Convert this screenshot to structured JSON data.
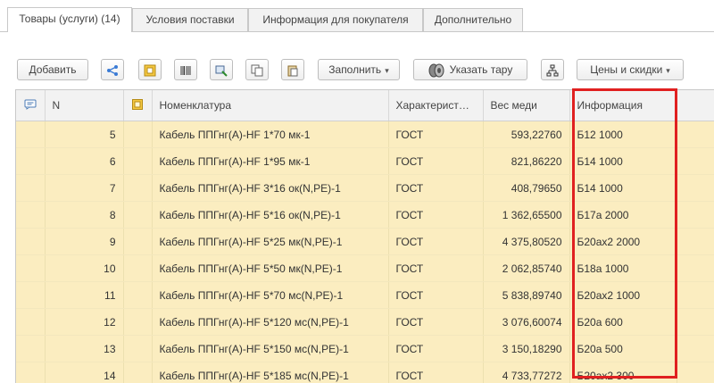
{
  "tabs": [
    {
      "label": "Товары (услуги) (14)"
    },
    {
      "label": "Условия поставки"
    },
    {
      "label": "Информация для покупателя"
    },
    {
      "label": "Дополнительно"
    }
  ],
  "toolbar": {
    "add_label": "Добавить",
    "fill_label": "Заполнить",
    "tare_label": "Указать тару",
    "prices_label": "Цены и скидки",
    "dropdown_caret": "▾"
  },
  "table": {
    "columns": {
      "n": "N",
      "nomenclature": "Номенклатура",
      "characteristic": "Характерист…",
      "weight": "Вес меди",
      "info": "Информация"
    },
    "rows": [
      {
        "n": "5",
        "name": "Кабель ППГнг(А)-HF 1*70 мк-1",
        "char": "ГОСТ",
        "weight": "593,22760",
        "info": "Б12 1000"
      },
      {
        "n": "6",
        "name": "Кабель ППГнг(А)-HF 1*95 мк-1",
        "char": "ГОСТ",
        "weight": "821,86220",
        "info": "Б14 1000"
      },
      {
        "n": "7",
        "name": "Кабель ППГнг(А)-HF 3*16 ок(N,PE)-1",
        "char": "ГОСТ",
        "weight": "408,79650",
        "info": "Б14 1000"
      },
      {
        "n": "8",
        "name": "Кабель ППГнг(А)-HF 5*16 ок(N,PE)-1",
        "char": "ГОСТ",
        "weight": "1 362,65500",
        "info": "Б17а 2000"
      },
      {
        "n": "9",
        "name": "Кабель ППГнг(А)-HF 5*25 мк(N,PE)-1",
        "char": "ГОСТ",
        "weight": "4 375,80520",
        "info": "Б20ах2 2000"
      },
      {
        "n": "10",
        "name": "Кабель ППГнг(А)-HF 5*50 мк(N,PE)-1",
        "char": "ГОСТ",
        "weight": "2 062,85740",
        "info": "Б18а 1000"
      },
      {
        "n": "11",
        "name": "Кабель ППГнг(А)-HF 5*70 мс(N,PE)-1",
        "char": "ГОСТ",
        "weight": "5 838,89740",
        "info": "Б20ах2 1000"
      },
      {
        "n": "12",
        "name": "Кабель ППГнг(А)-HF 5*120 мс(N,PE)-1",
        "char": "ГОСТ",
        "weight": "3 076,60074",
        "info": "Б20а 600"
      },
      {
        "n": "13",
        "name": "Кабель ППГнг(А)-HF 5*150 мс(N,PE)-1",
        "char": "ГОСТ",
        "weight": "3 150,18290",
        "info": "Б20а 500"
      },
      {
        "n": "14",
        "name": "Кабель ППГнг(А)-HF 5*185 мс(N,PE)-1",
        "char": "ГОСТ",
        "weight": "4 733,77272",
        "info": "Б20ах2 300"
      }
    ]
  },
  "colors": {
    "row_bg": "#fbedc0",
    "highlight_box": "#e02020"
  }
}
